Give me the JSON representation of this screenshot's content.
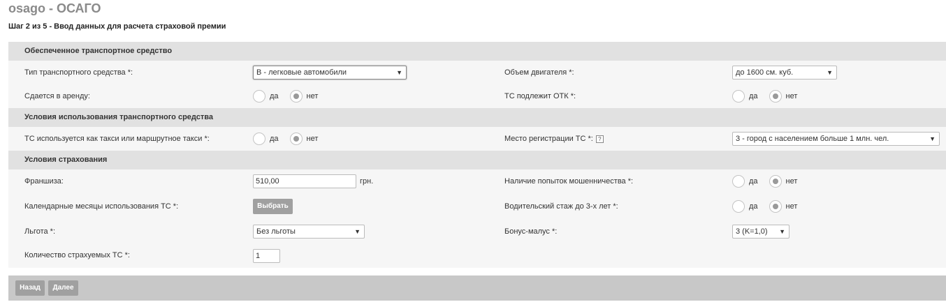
{
  "page": {
    "title": "osago - ОСАГО",
    "step": "Шаг 2 из 5 - Ввод данных для расчета страховой премии"
  },
  "sections": {
    "vehicle": {
      "title": "Обеспеченное транспортное средство",
      "vehicle_type_label": "Тип транспортного средства *:",
      "vehicle_type_value": "B - легковые автомобили",
      "engine_label": "Объем двигателя *:",
      "engine_value": "до 1600 см. куб.",
      "rent_label": "Сдается в аренду:",
      "otk_label": "ТС подлежит ОТК *:"
    },
    "usage": {
      "title": "Условия использования транспортного средства",
      "taxi_label": "ТС используется как такси или маршрутное такси *:",
      "registration_label": "Место регистрации ТС *:",
      "registration_value": "3 - город с населением больше 1 млн. чел."
    },
    "insurance": {
      "title": "Условия страхования",
      "franchise_label": "Франшиза:",
      "franchise_value": "510,00",
      "franchise_unit": "грн.",
      "fraud_label": "Наличие попыток мошенничества *:",
      "months_label": "Календарные месяцы использования ТС *:",
      "choose_button": "Выбрать",
      "experience_label": "Водительский стаж до 3-х лет *:",
      "benefit_label": "Льгота *:",
      "benefit_value": "Без льготы",
      "bonus_label": "Бонус-малус *:",
      "bonus_value": "3 (K=1,0)",
      "count_label": "Количество страхуемых ТС *:",
      "count_value": "1"
    }
  },
  "radio": {
    "yes": "да",
    "no": "нет"
  },
  "icons": {
    "help": "?",
    "dropdown": "▼"
  },
  "footer": {
    "back": "Назад",
    "next": "Далее"
  }
}
